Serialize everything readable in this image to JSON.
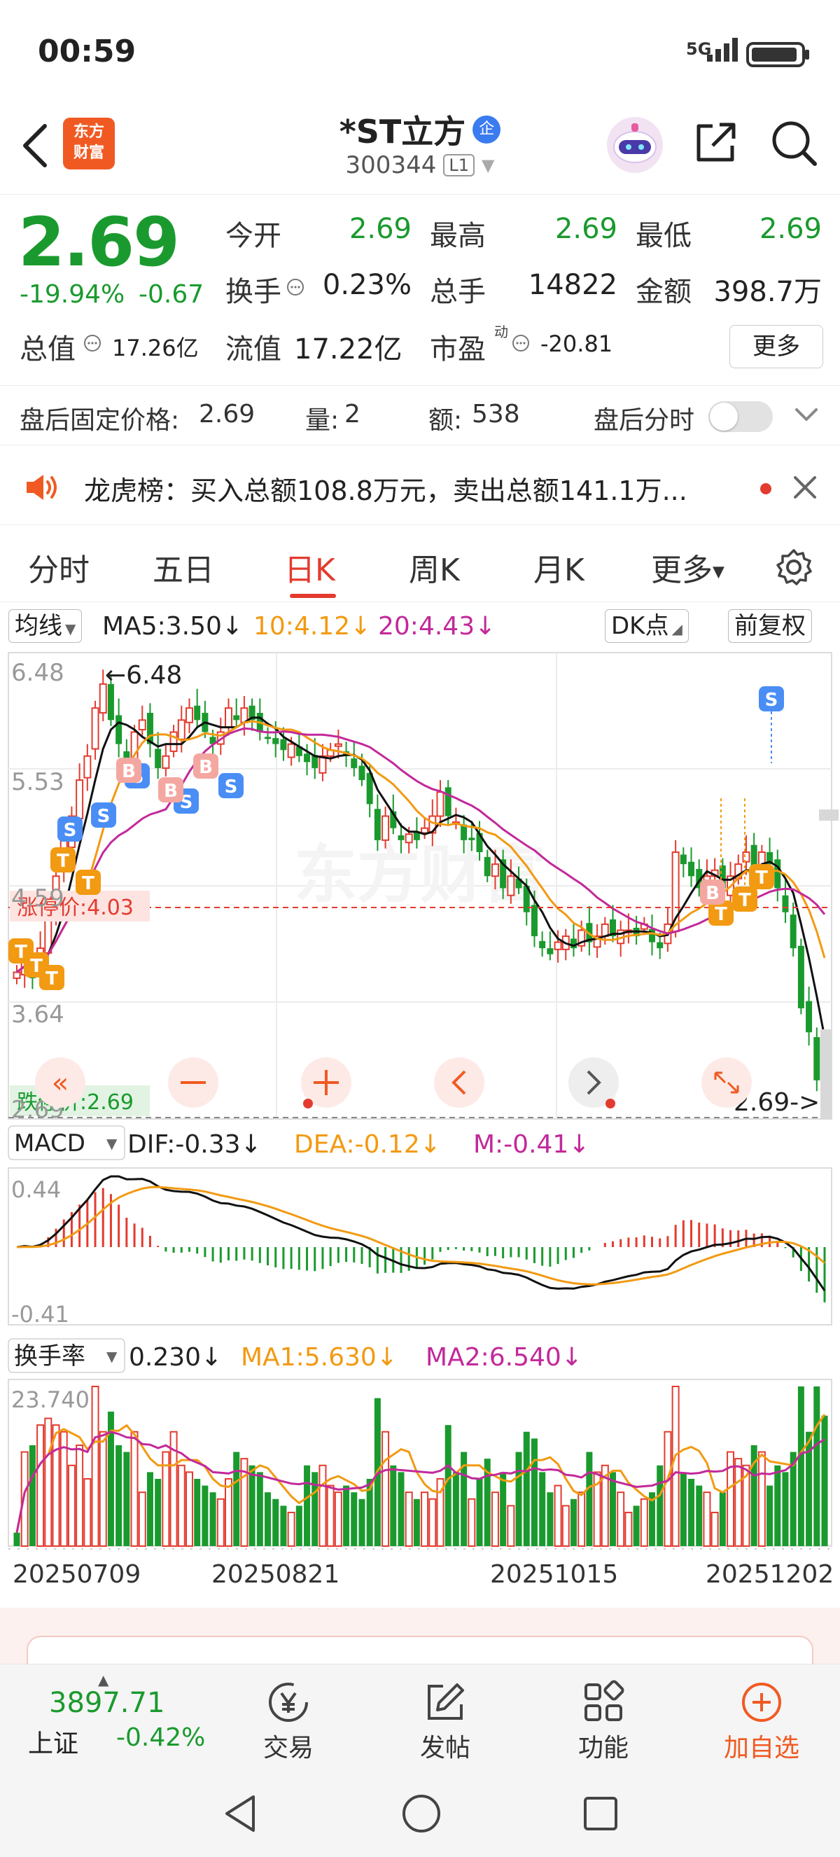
{
  "status_bar": {
    "time": "00:59",
    "network": "5G"
  },
  "header": {
    "logo_line1": "东方",
    "logo_line2": "财富",
    "title": "*ST立方",
    "badge": "企",
    "code": "300344",
    "level": "L1"
  },
  "quote": {
    "price": "2.69",
    "change_pct": "-19.94%",
    "change": "-0.67",
    "open_label": "今开",
    "open_value": "2.69",
    "high_label": "最高",
    "high_value": "2.69",
    "low_label": "最低",
    "low_value": "2.69",
    "turnover_label": "换手",
    "turnover_value": "0.23%",
    "volume_label": "总手",
    "volume_value": "14822",
    "amount_label": "金额",
    "amount_value": "398.7万",
    "mcap_label": "总值",
    "mcap_value": "17.26亿",
    "float_label": "流值",
    "float_value": "17.22亿",
    "pe_label": "市盈",
    "pe_sup": "动",
    "pe_value": "-20.81",
    "more_label": "更多"
  },
  "after_hours": {
    "price_label": "盘后固定价格:",
    "price_value": "2.69",
    "vol_label": "量:",
    "vol_value": "2",
    "amt_label": "额:",
    "amt_value": "538",
    "timeshare_label": "盘后分时"
  },
  "notice": {
    "text": "龙虎榜：买入总额108.8万元，卖出总额141.1万..."
  },
  "tabs": [
    {
      "label": "分时"
    },
    {
      "label": "五日"
    },
    {
      "label": "日K"
    },
    {
      "label": "周K"
    },
    {
      "label": "月K"
    },
    {
      "label": "更多"
    }
  ],
  "ma_legend": {
    "selector": "均线",
    "ma5": "MA5:3.50↓",
    "ma10": "10:4.12↓",
    "ma20": "20:4.43↓",
    "dk": "DK点",
    "adjust": "前复权"
  },
  "kline": {
    "y_labels": [
      "6.48",
      "5.53",
      "4.59",
      "3.64",
      "2.69"
    ],
    "max_marker": "←6.48",
    "limit_up": "涨停价:4.03",
    "limit_down": "跌停价:2.69",
    "last_marker": "2.69->",
    "watermark": "东方财富"
  },
  "macd": {
    "selector": "MACD",
    "dif": "DIF:-0.33↓",
    "dea": "DEA:-0.12↓",
    "m": "M:-0.41↓",
    "y_top": "0.44",
    "y_bottom": "-0.41"
  },
  "turnover": {
    "selector": "换手率",
    "value": "0.230↓",
    "ma1": "MA1:5.630↓",
    "ma2": "MA2:6.540↓",
    "y_top": "23.740"
  },
  "dates": [
    "20250709",
    "20250821",
    "20251015",
    "20251202"
  ],
  "bottom_bar": {
    "index_value": "3897.71",
    "index_name": "上证",
    "index_pct": "-0.42%",
    "nav": [
      {
        "label": "交易",
        "icon": "yen-icon"
      },
      {
        "label": "发帖",
        "icon": "pencil-icon"
      },
      {
        "label": "功能",
        "icon": "grid-icon"
      },
      {
        "label": "加自选",
        "icon": "plus-icon"
      }
    ]
  },
  "colors": {
    "up": "#e33b2f",
    "down": "#1a9a2e",
    "ma5": "#111111",
    "ma10": "#f29a12",
    "ma20": "#c2299a"
  },
  "chart_data": {
    "type": "candlestick",
    "x": [
      "20250709",
      "20250821",
      "20251015",
      "20251202"
    ],
    "ylim": [
      2.69,
      6.48
    ],
    "series": [
      {
        "name": "MA5",
        "values": [
          3.5
        ]
      },
      {
        "name": "10",
        "values": [
          4.12
        ]
      },
      {
        "name": "20",
        "values": [
          4.43
        ]
      }
    ],
    "close": [
      3.9,
      4.0,
      3.85,
      4.1,
      4.4,
      4.7,
      5.0,
      5.2,
      5.5,
      5.7,
      6.1,
      6.3,
      6.0,
      5.8,
      5.6,
      5.9,
      6.0,
      5.8,
      5.6,
      5.7,
      5.9,
      6.0,
      6.1,
      6.0,
      5.9,
      5.8,
      5.9,
      6.1,
      6.0,
      6.1,
      6.0,
      5.9,
      5.85,
      5.8,
      5.75,
      5.8,
      5.7,
      5.65,
      5.6,
      5.7,
      5.75,
      5.8,
      5.7,
      5.6,
      5.5,
      5.3,
      5.0,
      5.2,
      5.1,
      5.0,
      5.05,
      5.0,
      5.1,
      5.2,
      5.4,
      5.2,
      5.15,
      5.0,
      5.0,
      4.9,
      4.7,
      4.8,
      4.6,
      4.7,
      4.6,
      4.4,
      4.2,
      4.1,
      4.05,
      4.15,
      4.2,
      4.1,
      4.25,
      4.15,
      4.2,
      4.3,
      4.2,
      4.25,
      4.25,
      4.2,
      4.3,
      4.15,
      4.1,
      4.3,
      4.9,
      4.8,
      4.7,
      4.6,
      4.7,
      4.75,
      4.6,
      4.7,
      4.8,
      4.9,
      4.7,
      4.9,
      4.8,
      4.6,
      4.4,
      4.1,
      3.6,
      3.4,
      3.0,
      2.69
    ],
    "macd": {
      "dif": -0.33,
      "dea": -0.12,
      "m": -0.41,
      "ylim": [
        -0.41,
        0.44
      ]
    },
    "turnover": {
      "value": 0.23,
      "ma1": 5.63,
      "ma2": 6.54,
      "ymax": 23.74
    }
  }
}
